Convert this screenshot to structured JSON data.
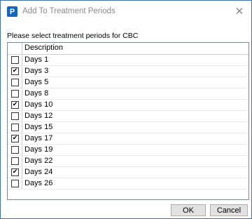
{
  "window": {
    "app_icon_letter": "P",
    "title": "Add To Treatment Periods",
    "close_glyph": "✕"
  },
  "prompt": "Please select treatment periods for CBC",
  "table": {
    "column_header": "Description",
    "rows": [
      {
        "label": "Days 1",
        "checked": false,
        "mark": ""
      },
      {
        "label": "Days 3",
        "checked": true,
        "mark": "✔"
      },
      {
        "label": "Days 5",
        "checked": false,
        "mark": ""
      },
      {
        "label": "Days 8",
        "checked": false,
        "mark": ""
      },
      {
        "label": "Days 10",
        "checked": true,
        "mark": "✔"
      },
      {
        "label": "Days 12",
        "checked": false,
        "mark": ""
      },
      {
        "label": "Days 15",
        "checked": false,
        "mark": ""
      },
      {
        "label": "Days 17",
        "checked": true,
        "mark": "✔"
      },
      {
        "label": "Days 19",
        "checked": false,
        "mark": ""
      },
      {
        "label": "Days 22",
        "checked": false,
        "mark": ""
      },
      {
        "label": "Days 24",
        "checked": true,
        "mark": "✔"
      },
      {
        "label": "Days 26",
        "checked": false,
        "mark": ""
      }
    ]
  },
  "buttons": {
    "ok_label": "OK",
    "cancel_label": "Cancel"
  }
}
